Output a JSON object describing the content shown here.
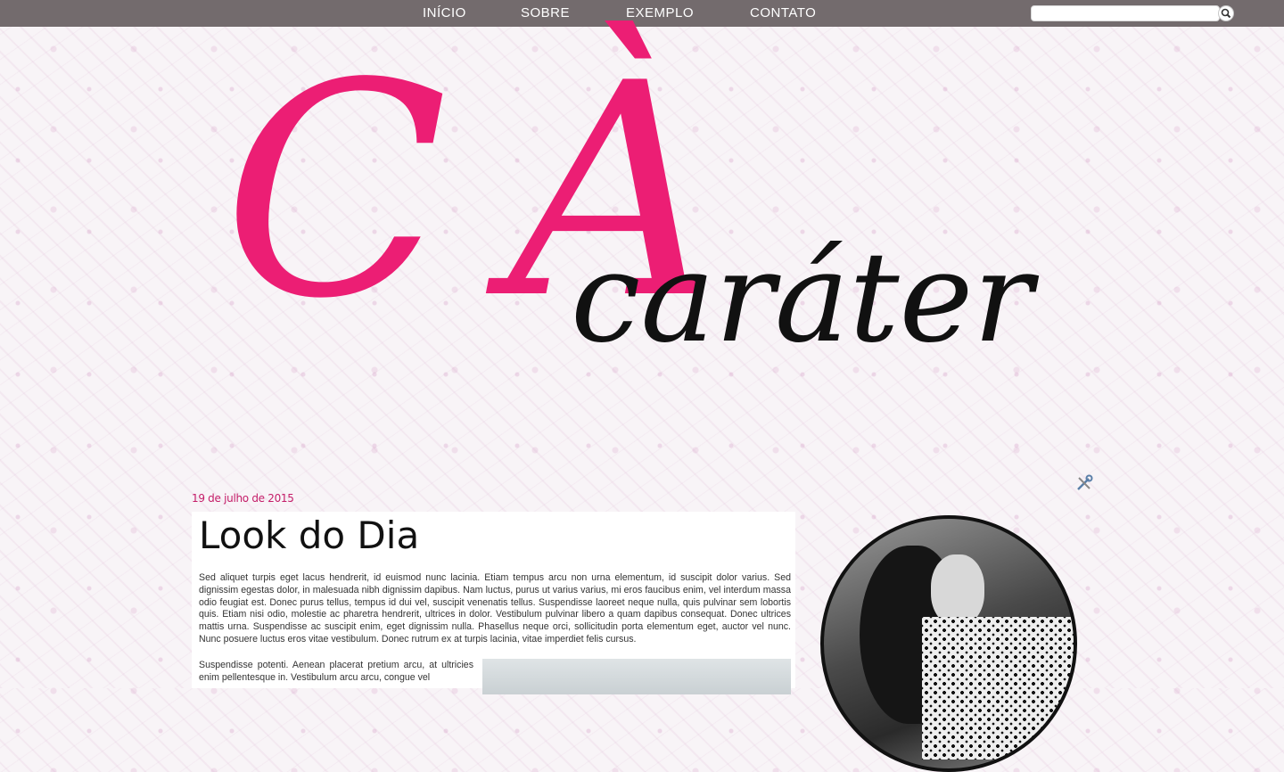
{
  "nav": {
    "items": [
      {
        "label": "INÍCIO"
      },
      {
        "label": "SOBRE"
      },
      {
        "label": "EXEMPLO"
      },
      {
        "label": "CONTATO"
      }
    ],
    "search": {
      "value": "",
      "placeholder": ""
    },
    "search_icon": "search-icon"
  },
  "header": {
    "logo_letter_c": "C",
    "logo_letter_a": "À",
    "logo_rest": "caráter",
    "colors": {
      "accent": "#ec1e74",
      "text": "#111111"
    }
  },
  "post": {
    "date": "19 de julho de 2015",
    "title": "Look do Dia",
    "paragraph1": "Sed aliquet turpis eget lacus hendrerit, id euismod nunc lacinia. Etiam tempus arcu non urna elementum, id suscipit dolor varius. Sed dignissim egestas dolor, in malesuada nibh dignissim dapibus. Nam luctus, purus ut varius varius, mi eros faucibus enim, vel interdum massa odio feugiat est. Donec purus tellus, tempus id dui vel, suscipit venenatis tellus. Suspendisse laoreet neque nulla, quis pulvinar sem lobortis quis. Etiam nisi odio, molestie ac pharetra hendrerit, ultrices in dolor. Vestibulum pulvinar libero a quam dapibus consequat. Donec ultrices mattis urna. Suspendisse ac suscipit enim, eget dignissim nulla. Phasellus neque orci, sollicitudin porta elementum eget, auctor vel nunc. Nunc posuere luctus eros vitae vestibulum. Donec rutrum ex at turpis lacinia, vitae imperdiet felis cursus.",
    "paragraph2": "Suspendisse potenti. Aenean placerat pretium arcu, at ultricies enim pellentesque in. Vestibulum arcu arcu, congue vel"
  },
  "icons": {
    "tools": "tools-icon",
    "search": "search-icon"
  },
  "colors": {
    "topbar": "#736b6d",
    "date": "#c41c68"
  }
}
